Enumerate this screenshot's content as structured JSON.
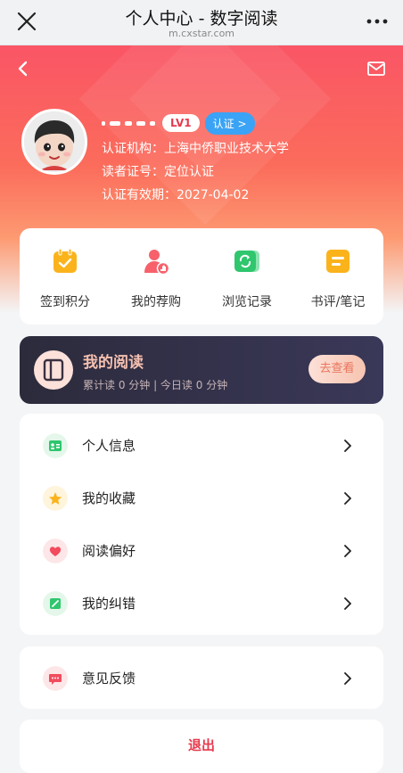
{
  "topbar": {
    "title": "个人中心 - 数字阅读",
    "url": "m.cxstar.com"
  },
  "profile": {
    "level": "LV1",
    "verify_label": "认证 >",
    "institution": "认证机构：上海中侨职业技术大学",
    "reader_id": "读者证号：定位认证",
    "expiry": "认证有效期：2027-04-02"
  },
  "quick_actions": [
    {
      "label": "签到积分",
      "icon": "calendar-check-icon",
      "color": "#fbb31c"
    },
    {
      "label": "我的荐购",
      "icon": "recommend-user-icon",
      "color": "#f7616b"
    },
    {
      "label": "浏览记录",
      "icon": "refresh-history-icon",
      "color": "#2fc66e"
    },
    {
      "label": "书评/笔记",
      "icon": "note-icon",
      "color": "#fbb31c"
    }
  ],
  "reading": {
    "title": "我的阅读",
    "summary": "累计读 0 分钟 | 今日读 0 分钟",
    "button": "去查看"
  },
  "menu": [
    {
      "label": "个人信息",
      "icon": "id-card-icon"
    },
    {
      "label": "我的收藏",
      "icon": "star-icon"
    },
    {
      "label": "阅读偏好",
      "icon": "heart-icon"
    },
    {
      "label": "我的纠错",
      "icon": "edit-icon"
    }
  ],
  "feedback": {
    "label": "意见反馈",
    "icon": "message-icon"
  },
  "logout": "退出"
}
